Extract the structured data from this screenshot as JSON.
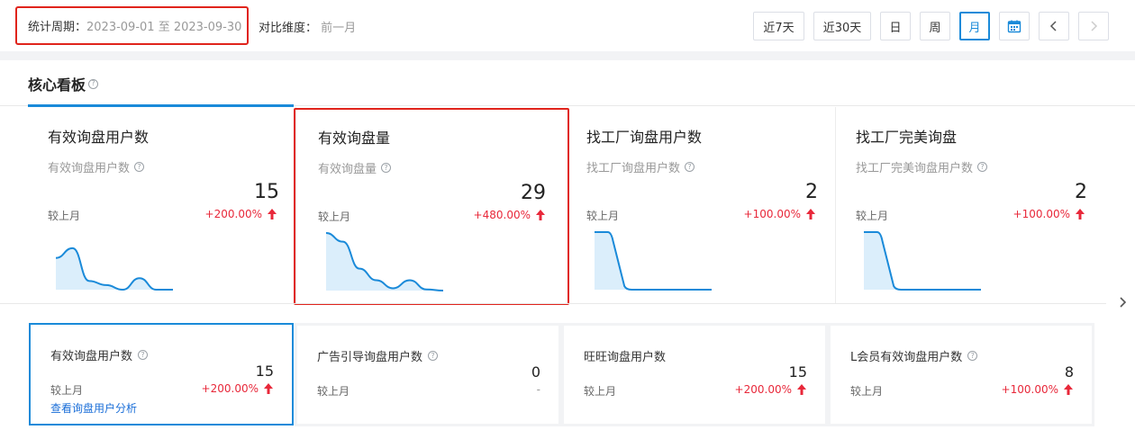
{
  "header": {
    "period_label": "统计周期：",
    "period_value": "2023-09-01 至 2023-09-30",
    "compare_label": "对比维度：",
    "compare_value": "前一月",
    "buttons": [
      {
        "label": "近7天",
        "name": "last-7-days-button"
      },
      {
        "label": "近30天",
        "name": "last-30-days-button"
      },
      {
        "label": "日",
        "name": "day-button"
      },
      {
        "label": "周",
        "name": "week-button"
      },
      {
        "label": "月",
        "name": "month-button",
        "active": true
      }
    ],
    "icons": {
      "calendar": "calendar-icon",
      "prev": "chevron-left-icon",
      "next": "chevron-right-icon"
    }
  },
  "board": {
    "title": "核心看板",
    "cards": [
      {
        "title": "有效询盘用户数",
        "subtitle": "有效询盘用户数",
        "value": "15",
        "compare_label": "较上月",
        "change": "+200.00%",
        "trend": [
          0.55,
          0.72,
          0.15,
          0.08,
          0.0,
          0.2,
          0.0,
          0.0
        ]
      },
      {
        "title": "有效询盘量",
        "subtitle": "有效询盘量",
        "value": "29",
        "compare_label": "较上月",
        "change": "+480.00%",
        "trend": [
          1.0,
          0.85,
          0.38,
          0.18,
          0.04,
          0.18,
          0.02,
          0.0
        ]
      },
      {
        "title": "找工厂询盘用户数",
        "subtitle": "找工厂询盘用户数",
        "value": "2",
        "compare_label": "较上月",
        "change": "+100.00%",
        "trend": [
          1.0,
          1.0,
          0.0,
          0.0,
          0.0,
          0.0,
          0.0,
          0.0
        ]
      },
      {
        "title": "找工厂完美询盘",
        "subtitle": "找工厂完美询盘用户数",
        "value": "2",
        "compare_label": "较上月",
        "change": "+100.00%",
        "trend": [
          1.0,
          1.0,
          0.0,
          0.0,
          0.0,
          0.0,
          0.0,
          0.0
        ]
      }
    ]
  },
  "metrics": [
    {
      "title": "有效询盘用户数",
      "value": "15",
      "compare_label": "较上月",
      "change": "+200.00%",
      "link": "查看询盘用户分析",
      "help": true
    },
    {
      "title": "广告引导询盘用户数",
      "value": "0",
      "compare_label": "较上月",
      "change": "-",
      "help": true
    },
    {
      "title": "旺旺询盘用户数",
      "value": "15",
      "compare_label": "较上月",
      "change": "+200.00%",
      "help": false
    },
    {
      "title": "L会员有效询盘用户数",
      "value": "8",
      "compare_label": "较上月",
      "change": "+100.00%",
      "help": true
    }
  ],
  "colors": {
    "accent": "#1a8ad9",
    "up": "#e8283a",
    "highlight": "#e0241c",
    "area": "#dbeefb"
  }
}
